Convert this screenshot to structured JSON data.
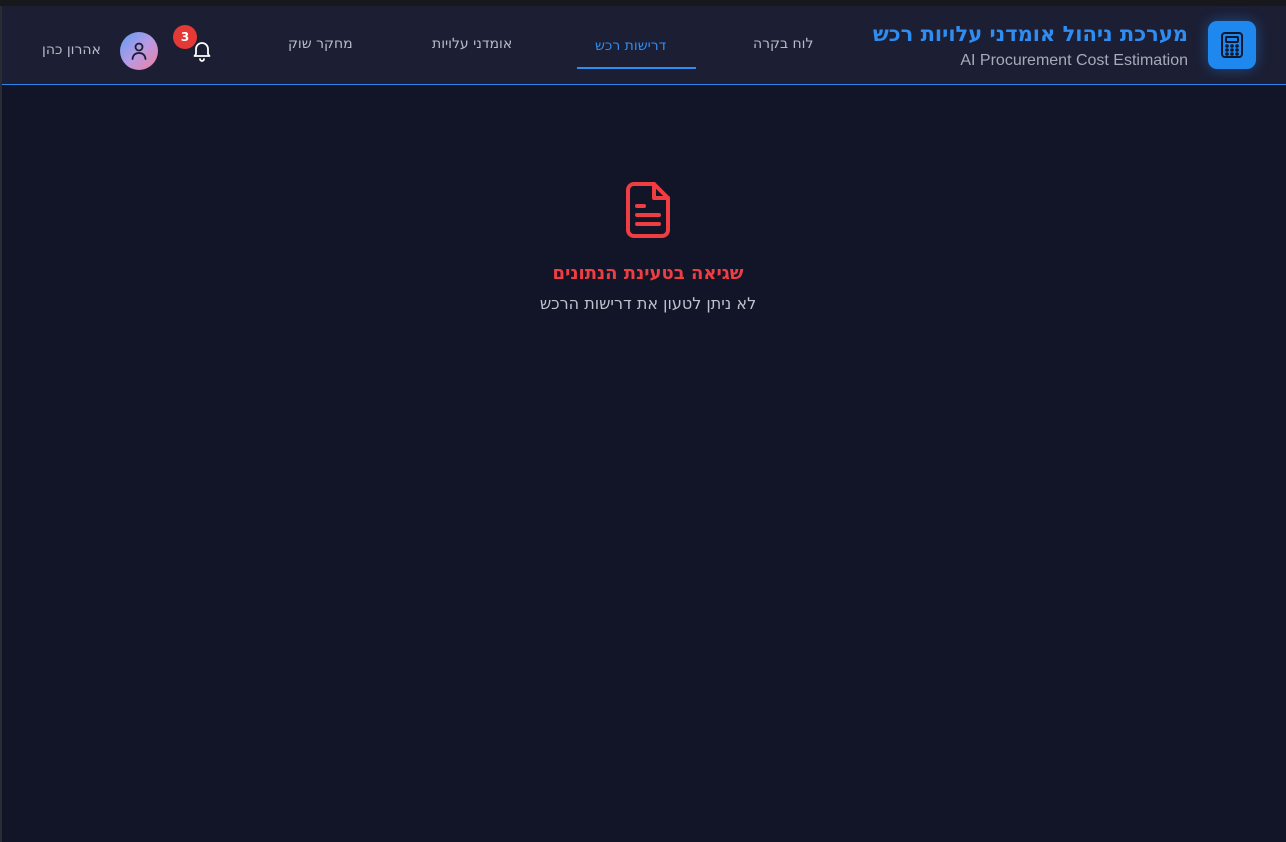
{
  "header": {
    "title": "מערכת ניהול אומדני עלויות רכש",
    "subtitle": "AI Procurement Cost Estimation",
    "logo_icon": "calculator-icon",
    "accent_color": "#2f8cf0"
  },
  "nav": {
    "tabs": [
      {
        "label": "לוח בקרה",
        "active": false
      },
      {
        "label": "דרישות רכש",
        "active": true
      },
      {
        "label": "אומדני עלויות",
        "active": false
      },
      {
        "label": "מחקר שוק",
        "active": false
      }
    ]
  },
  "user": {
    "notifications_count": "3",
    "name": "אהרון כהן",
    "avatar_icon": "user-icon"
  },
  "error": {
    "icon": "document-icon",
    "title": "שגיאה בטעינת הנתונים",
    "message": "לא ניתן לטעון את דרישות הרכש",
    "color": "#ef3e42"
  }
}
